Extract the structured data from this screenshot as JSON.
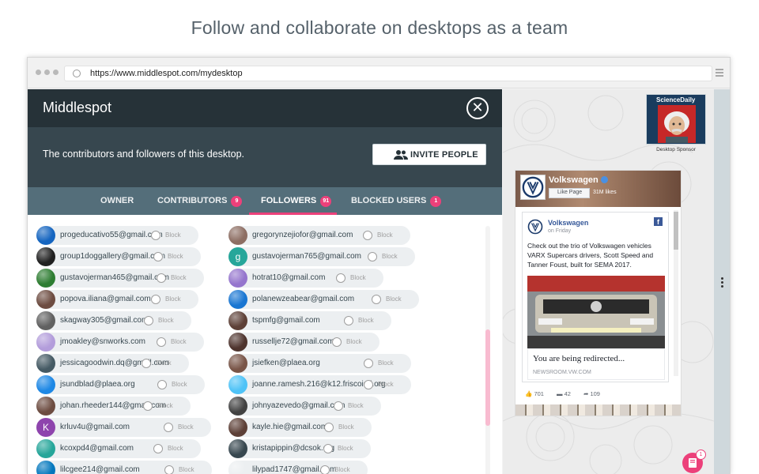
{
  "headline": "Follow and collaborate on desktops as a team",
  "browser": {
    "url": "https://www.middlespot.com/mydesktop"
  },
  "panel": {
    "title": "Middlespot",
    "description": "The contributors and followers of this desktop.",
    "invite_label": "INVITE PEOPLE",
    "tabs": [
      {
        "label": "OWNER"
      },
      {
        "label": "CONTRIBUTORS",
        "badge": "9"
      },
      {
        "label": "FOLLOWERS",
        "badge": "91",
        "active": true
      },
      {
        "label": "BLOCKED USERS",
        "badge": "1"
      }
    ],
    "block_label": "Block",
    "followers": [
      {
        "email": "progeducativo55@gmail.com",
        "avatar": "#1565c0"
      },
      {
        "email": "gregorynzejiofor@gmail.com",
        "avatar": "#8d6e63"
      },
      {
        "email": "group1doggallery@gmail.com",
        "avatar": "#212121"
      },
      {
        "email": "gustavojerman765@gmail.com",
        "avatar": "#26a69a",
        "letter": "g"
      },
      {
        "email": "gustavojerman465@gmail.com",
        "avatar": "#2e7d32"
      },
      {
        "email": "hotrat10@gmail.com",
        "avatar": "#9575cd"
      },
      {
        "email": "popova.iliana@gmail.com",
        "avatar": "#6d4c41"
      },
      {
        "email": "polanewzeabear@gmail.com",
        "avatar": "#1976d2"
      },
      {
        "email": "skagway305@gmail.com",
        "avatar": "#616161"
      },
      {
        "email": "tspmfg@gmail.com",
        "avatar": "#5d4037"
      },
      {
        "email": "jmoakley@snworks.com",
        "avatar": "#b39ddb"
      },
      {
        "email": "russellje72@gmail.com",
        "avatar": "#4e342e"
      },
      {
        "email": "jessicagoodwin.dq@gmail.com",
        "avatar": "#455a64"
      },
      {
        "email": "jsiefken@plaea.org",
        "avatar": "#795548"
      },
      {
        "email": "jsundblad@plaea.org",
        "avatar": "#1e88e5"
      },
      {
        "email": "joanne.ramesh.216@k12.friscoisd.org",
        "avatar": "#4fc3f7"
      },
      {
        "email": "johan.rheeder144@gmail.com",
        "avatar": "#6d4c41"
      },
      {
        "email": "johnyazevedo@gmail.com",
        "avatar": "#424242"
      },
      {
        "email": "krluv4u@gmail.com",
        "avatar": "#8e44ad",
        "letter": "K"
      },
      {
        "email": "kayle.hie@gmail.com",
        "avatar": "#5d4037"
      },
      {
        "email": "kcoxpd4@gmail.com",
        "avatar": "#26a69a"
      },
      {
        "email": "kristapippin@dcsok.org",
        "avatar": "#37474f"
      },
      {
        "email": "lilcgee214@gmail.com",
        "avatar": "#0277bd"
      },
      {
        "email": "lilypad1747@gmail.com",
        "avatar": "#eceff1"
      }
    ]
  },
  "sponsor": {
    "brand": "ScienceDaily",
    "caption": "Desktop Sponsor"
  },
  "facebook": {
    "page_name": "Volkswagen",
    "like_label": "Like Page",
    "likes": "31M likes",
    "post_author": "Volkswagen",
    "post_date": "on Friday",
    "post_text": "Check out the trio of Volkswagen vehicles VARX Supercars drivers, Scott Speed and Tanner Foust, built for SEMA 2017.",
    "link_title": "You are being redirected...",
    "link_domain": "NEWSROOM.VW.COM",
    "reactions": "701",
    "comments": "42",
    "shares": "109"
  },
  "notifications": {
    "count": "1"
  },
  "colors": {
    "accent": "#ec407a",
    "header": "#263238",
    "subheader": "#37474f",
    "tabs": "#546e7a"
  }
}
